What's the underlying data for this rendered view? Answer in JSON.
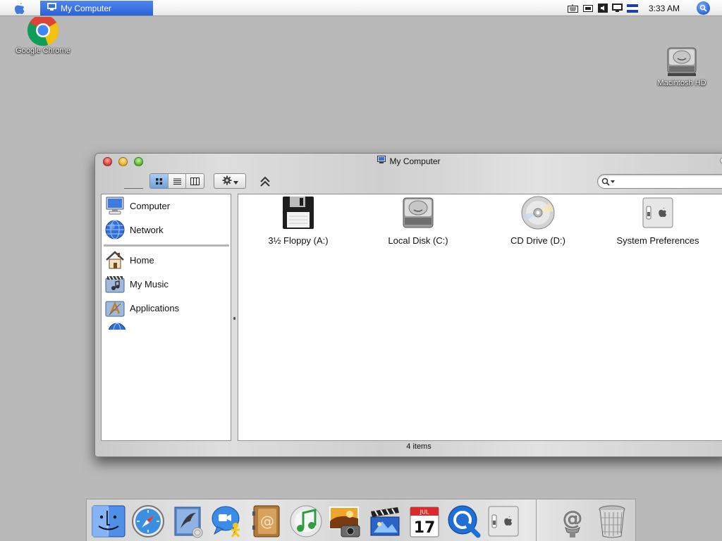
{
  "menubar": {
    "active_window": "My Computer",
    "clock": "3:33 AM",
    "tray_icons": [
      "keyboard-icon",
      "display-icon",
      "volume-icon",
      "monitor-icon",
      "flag-icon"
    ]
  },
  "desktop": {
    "icons": [
      {
        "label": "Google Chrome",
        "icon": "chrome-icon"
      },
      {
        "label": "Macintosh HD",
        "icon": "hard-disk-icon"
      }
    ]
  },
  "window": {
    "title": "My Computer",
    "view_modes": [
      "icon-view",
      "list-view",
      "column-view"
    ],
    "active_view": "icon-view",
    "search": {
      "value": "",
      "placeholder": ""
    },
    "sidebar": {
      "items": [
        {
          "label": "Computer",
          "icon": "computer-icon"
        },
        {
          "label": "Network",
          "icon": "network-globe-icon"
        },
        {
          "label": "Home",
          "icon": "home-icon"
        },
        {
          "label": "My Music",
          "icon": "music-folder-icon"
        },
        {
          "label": "Applications",
          "icon": "applications-folder-icon"
        }
      ]
    },
    "files": [
      {
        "label": "3½ Floppy (A:)",
        "icon": "floppy-disk-icon"
      },
      {
        "label": "Local Disk (C:)",
        "icon": "hard-disk-icon"
      },
      {
        "label": "CD Drive (D:)",
        "icon": "cd-drive-icon"
      },
      {
        "label": "System Preferences",
        "icon": "system-preferences-icon"
      }
    ],
    "status": "4 items"
  },
  "dock": {
    "items": [
      "finder-icon",
      "safari-icon",
      "mail-icon",
      "ichat-icon",
      "address-book-icon",
      "itunes-icon",
      "iphoto-icon",
      "imovie-icon",
      "ical-icon",
      "quicktime-icon",
      "system-preferences-icon",
      "mail-at-icon",
      "trash-icon"
    ],
    "calendar_date": "17",
    "calendar_month": "JUL"
  },
  "colors": {
    "desktop": "#b9b9b9",
    "selection_blue": "#2d62d5",
    "window_metal": "#d6d6d6"
  }
}
